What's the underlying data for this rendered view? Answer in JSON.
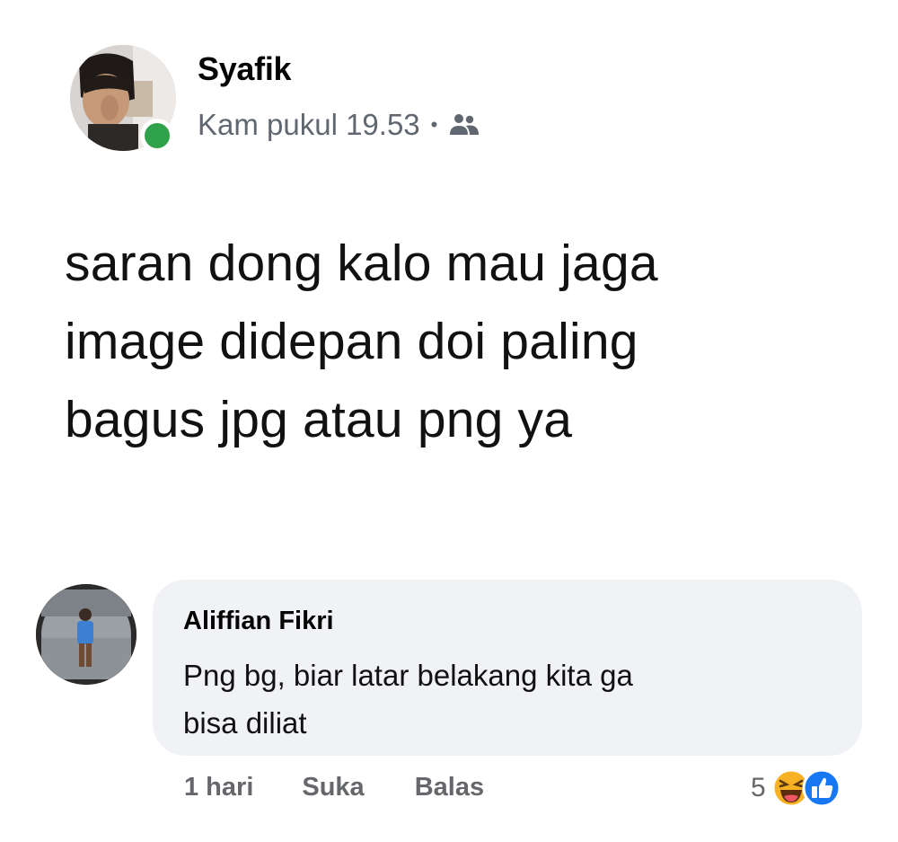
{
  "post": {
    "author": "Syafik",
    "timestamp": "Kam pukul 19.53",
    "separator": "•",
    "audience_icon": "group-icon",
    "text_lines": [
      "saran dong kalo mau jaga",
      "image didepan doi paling",
      "bagus jpg atau png ya"
    ]
  },
  "comment": {
    "author": "Aliffian Fikri",
    "text_lines": [
      "Png bg, biar latar belakang kita ga",
      "bisa diliat"
    ],
    "time": "1 hari",
    "like_label": "Suka",
    "reply_label": "Balas",
    "reaction_count": "5",
    "reaction_icons": [
      "haha-icon",
      "like-icon"
    ]
  },
  "colors": {
    "online": "#31a24c",
    "bubble": "#f0f2f5",
    "meta_text": "#65676b",
    "like_blue": "#1877f2",
    "haha_yellow": "#f7b125"
  }
}
